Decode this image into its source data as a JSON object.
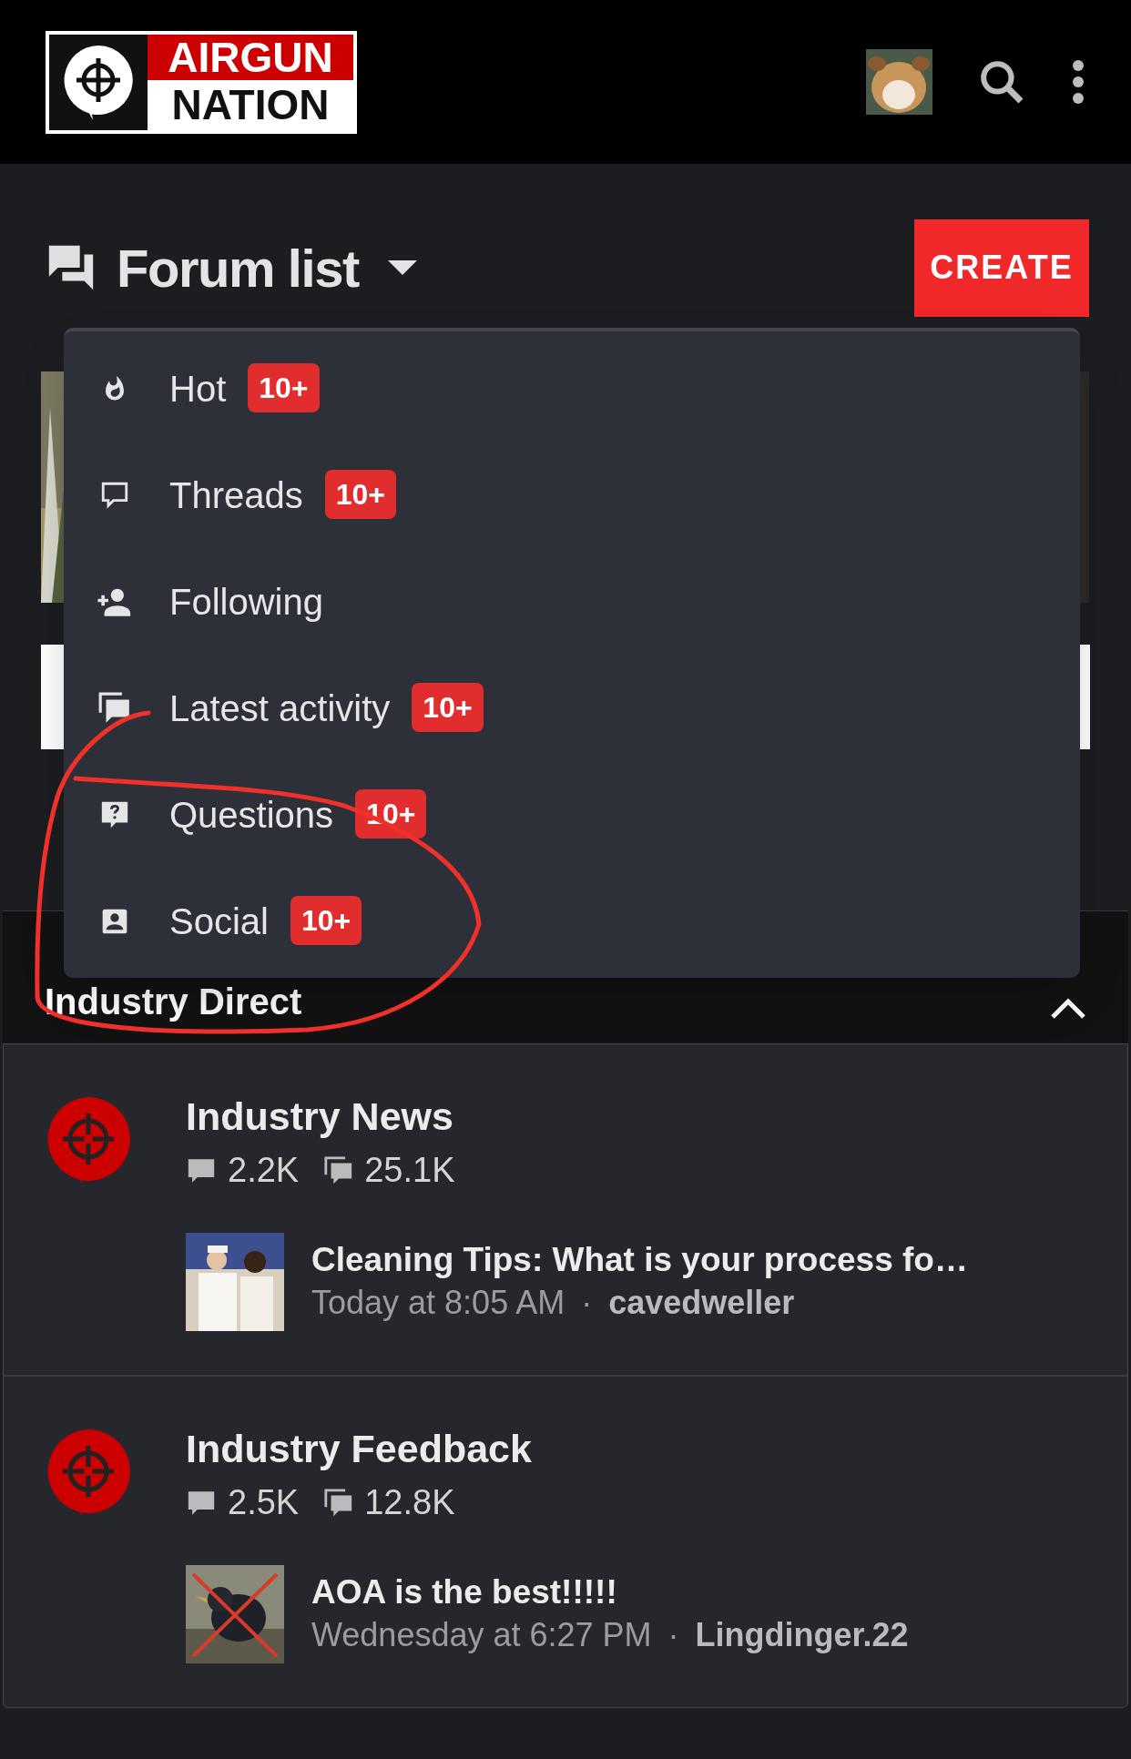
{
  "header": {
    "logo": {
      "line_1": "AIRGUN",
      "line_2": "NATION"
    }
  },
  "page_title": {
    "text": "Forum list"
  },
  "create_button": {
    "label": "CREATE"
  },
  "menu": {
    "items": [
      {
        "label": "Hot",
        "badge": "10+"
      },
      {
        "label": "Threads",
        "badge": "10+"
      },
      {
        "label": "Following"
      },
      {
        "label": "Latest activity",
        "badge": "10+"
      },
      {
        "label": "Questions",
        "badge": "10+"
      },
      {
        "label": "Social",
        "badge": "10+"
      }
    ]
  },
  "section": {
    "title": "Industry Direct",
    "expanded": true
  },
  "forums": [
    {
      "title": "Industry News",
      "threads": "2.2K",
      "messages": "25.1K",
      "latest": {
        "title": "Cleaning Tips: What is your process fo…",
        "time": "Today at 8:05 AM",
        "separator": "·",
        "user": "cavedweller"
      }
    },
    {
      "title": "Industry Feedback",
      "threads": "2.5K",
      "messages": "12.8K",
      "latest": {
        "title": "AOA is the best!!!!!",
        "time": "Wednesday at 6:27 PM",
        "separator": "·",
        "user": "Lingdinger.22"
      }
    }
  ]
}
